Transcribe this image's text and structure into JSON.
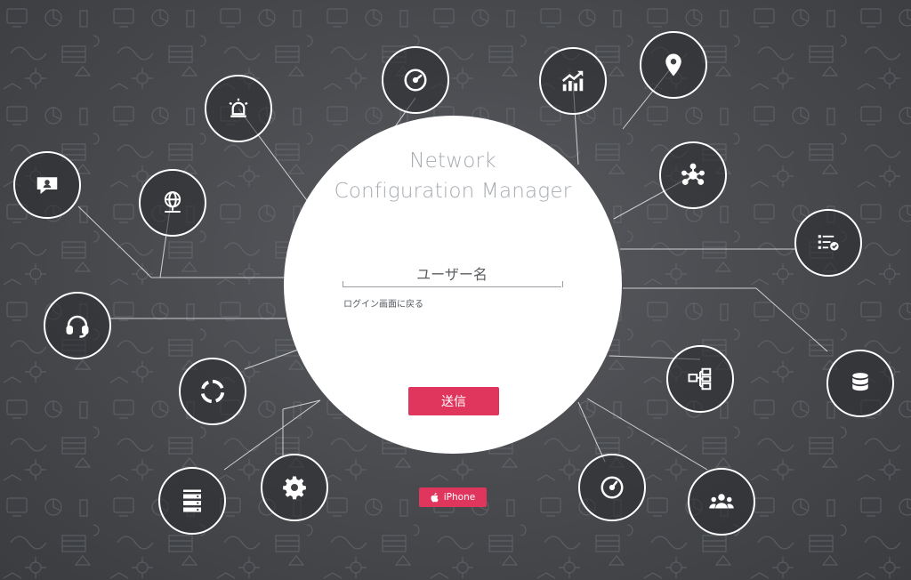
{
  "app": {
    "title_line1": "Network",
    "title_line2": "Configuration Manager"
  },
  "login": {
    "username_placeholder": "ユーザー名",
    "back_link": "ログイン画面に戻る",
    "submit_label": "送信"
  },
  "badge": {
    "label": "iPhone",
    "icon": "apple-icon"
  },
  "colors": {
    "accent": "#e0365d",
    "title": "#a7abb0",
    "background": "#4a4c50"
  },
  "nodes": [
    {
      "name": "speedometer-icon"
    },
    {
      "name": "trending-chart-icon"
    },
    {
      "name": "map-pin-icon"
    },
    {
      "name": "alarm-bell-icon"
    },
    {
      "name": "chat-bubble-icon"
    },
    {
      "name": "globe-network-icon"
    },
    {
      "name": "hierarchy-network-icon"
    },
    {
      "name": "checklist-icon"
    },
    {
      "name": "headset-icon"
    },
    {
      "name": "database-icon"
    },
    {
      "name": "workflow-icon"
    },
    {
      "name": "sync-icon"
    },
    {
      "name": "server-rack-icon"
    },
    {
      "name": "gear-icon"
    },
    {
      "name": "gauge-icon"
    },
    {
      "name": "user-group-icon"
    }
  ]
}
